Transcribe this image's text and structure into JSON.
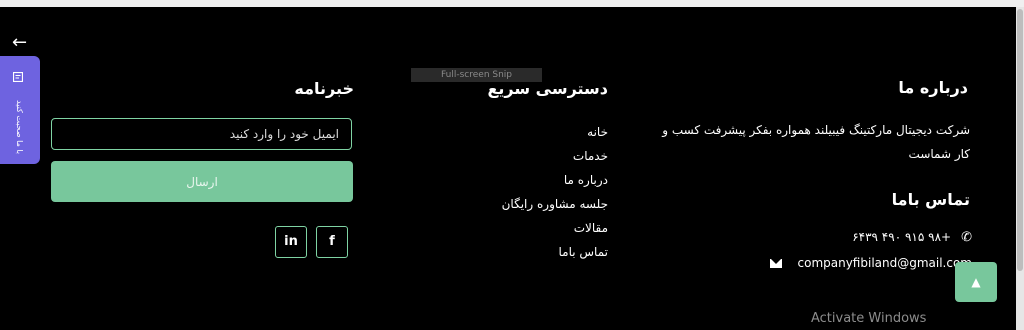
{
  "colors": {
    "accent": "#78c79c",
    "accent_border": "#7fd3a4",
    "side_tab": "#6e63e0",
    "background": "#000000"
  },
  "side": {
    "arrow": "←",
    "chat_label": "با ما صحبت کنید",
    "icon": "chat-icon"
  },
  "snip_label": "Full-screen Snip",
  "about": {
    "title": "درباره ما",
    "text": "شرکت دیجیتال مارکتینگ فیبیلند همواره بفکر پیشرفت کسب و کار شماست"
  },
  "contact": {
    "title": "تماس باما",
    "phone": "+۹۸ ۹۱۵ ۴۹۰ ۶۴۳۹",
    "email": "companyfibiland@gmail.com",
    "phone_icon": "phone-icon",
    "email_icon": "envelope-icon"
  },
  "quick_access": {
    "title": "دسترسی سریع",
    "links": [
      "خانه",
      "خدمات",
      "درباره ما",
      "جلسه مشاوره رایگان",
      "مقالات",
      "تماس باما"
    ]
  },
  "newsletter": {
    "title": "خبرنامه",
    "email_placeholder": "ایمیل خود را وارد کنید",
    "submit_label": "ارسال"
  },
  "social": {
    "linkedin": "in",
    "facebook": "f"
  },
  "scroll_top_icon": "chevron-up-icon",
  "watermark": "Activate Windows"
}
